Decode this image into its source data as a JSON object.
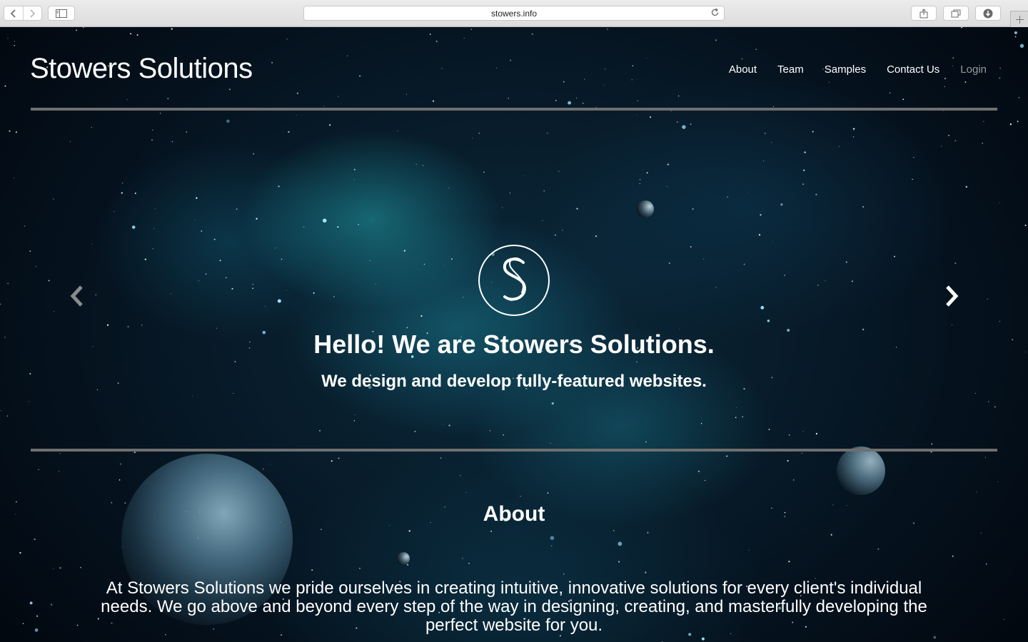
{
  "browser": {
    "url": "stowers.info",
    "icons": {
      "back": "chevron-left-icon",
      "forward": "chevron-right-icon",
      "sidebar": "sidebar-icon",
      "reload": "reload-icon",
      "share": "share-icon",
      "tabs": "tabs-icon",
      "download": "download-icon",
      "new_tab": "plus-icon"
    }
  },
  "header": {
    "brand": "Stowers Solutions",
    "nav": [
      {
        "label": "About"
      },
      {
        "label": "Team"
      },
      {
        "label": "Samples"
      },
      {
        "label": "Contact Us"
      },
      {
        "label": "Login"
      }
    ]
  },
  "hero": {
    "logo_letter": "S",
    "title": "Hello! We are Stowers Solutions.",
    "subtitle": "We design and develop fully-featured websites."
  },
  "about": {
    "title": "About",
    "text": "At Stowers Solutions we pride ourselves in creating intuitive, innovative solutions for every client's individual needs. We go above and beyond every step of the way in designing, creating, and masterfully developing the perfect website for you."
  },
  "colors": {
    "background": "#061522",
    "nebula": "#28bec8",
    "text": "#ffffff",
    "muted_link": "#9a9a9a",
    "rule": "#6f6f6f"
  }
}
